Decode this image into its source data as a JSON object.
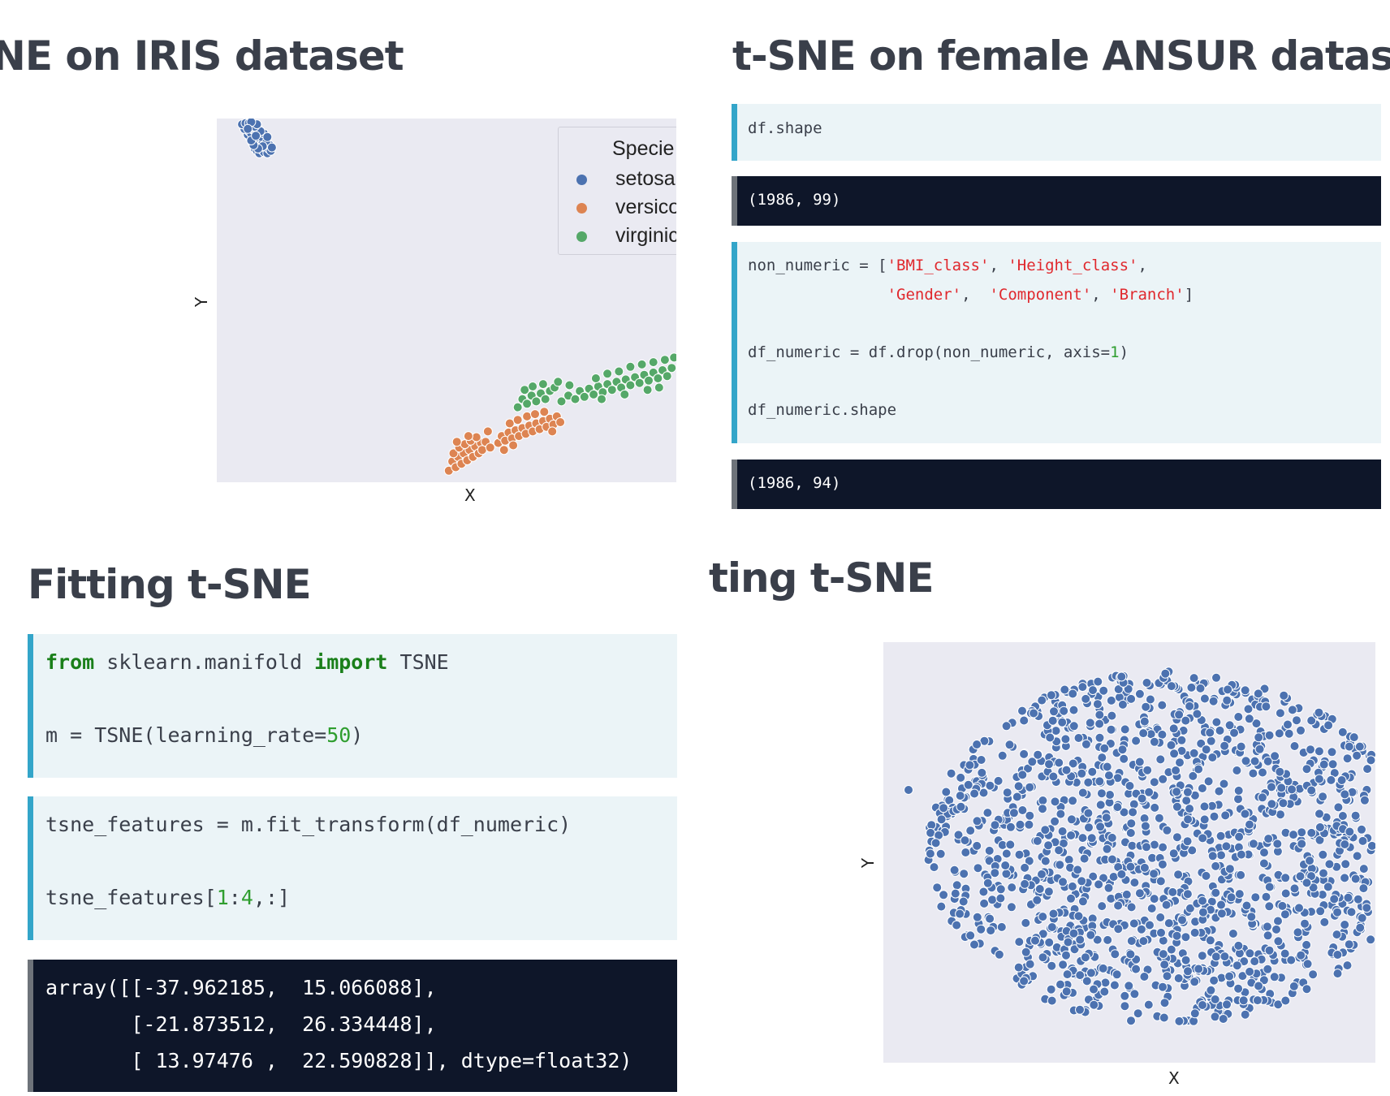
{
  "colors": {
    "title": "#3a3f4a",
    "code_bg": "#ebf4f7",
    "code_accent": "#33a5c9",
    "output_bg": "#0e1629",
    "output_accent": "#6e737a",
    "keyword": "#1a7f1a",
    "string": "#e0282d",
    "number": "#2f9e2f",
    "plot_bg": "#eaeaf2"
  },
  "top_left": {
    "title": "NE on IRIS dataset",
    "chart_data": {
      "type": "scatter",
      "xlabel": "X",
      "ylabel": "Y",
      "legend": {
        "title": "Specie",
        "placement": "top-right",
        "entries": [
          "setosa",
          "versico",
          "virginic"
        ]
      },
      "series": [
        {
          "name": "setosa",
          "color": "#4c72b0",
          "points": [
            [
              0.33,
              0.09
            ],
            [
              0.35,
              0.07
            ],
            [
              0.37,
              0.05
            ],
            [
              0.38,
              0.12
            ],
            [
              0.39,
              0.08
            ],
            [
              0.41,
              0.06
            ],
            [
              0.42,
              0.1
            ],
            [
              0.44,
              0.05
            ],
            [
              0.45,
              0.09
            ],
            [
              0.46,
              0.12
            ],
            [
              0.31,
              0.14
            ],
            [
              0.34,
              0.15
            ],
            [
              0.36,
              0.13
            ],
            [
              0.38,
              0.16
            ],
            [
              0.4,
              0.14
            ],
            [
              0.42,
              0.17
            ],
            [
              0.29,
              0.18
            ],
            [
              0.31,
              0.2
            ],
            [
              0.33,
              0.17
            ],
            [
              0.35,
              0.19
            ],
            [
              0.37,
              0.21
            ],
            [
              0.39,
              0.19
            ],
            [
              0.41,
              0.22
            ],
            [
              0.27,
              0.21
            ],
            [
              0.28,
              0.24
            ],
            [
              0.3,
              0.22
            ],
            [
              0.32,
              0.25
            ],
            [
              0.34,
              0.23
            ],
            [
              0.36,
              0.26
            ],
            [
              0.38,
              0.24
            ],
            [
              0.24,
              0.26
            ],
            [
              0.26,
              0.28
            ],
            [
              0.29,
              0.27
            ],
            [
              0.31,
              0.29
            ],
            [
              0.33,
              0.28
            ],
            [
              0.35,
              0.3
            ],
            [
              0.22,
              0.3
            ],
            [
              0.25,
              0.31
            ],
            [
              0.28,
              0.31
            ],
            [
              0.3,
              0.32
            ],
            [
              0.43,
              0.14
            ],
            [
              0.44,
              0.19
            ],
            [
              0.4,
              0.11
            ],
            [
              0.36,
              0.09
            ],
            [
              0.32,
              0.12
            ],
            [
              0.47,
              0.07
            ],
            [
              0.48,
              0.1
            ],
            [
              0.3,
              0.16
            ],
            [
              0.27,
              0.26
            ],
            [
              0.34,
              0.2
            ]
          ]
        },
        {
          "name": "versico",
          "color": "#dd8452",
          "points": [
            [
              2.02,
              -2.7
            ],
            [
              2.05,
              -2.62
            ],
            [
              2.08,
              -2.67
            ],
            [
              2.1,
              -2.58
            ],
            [
              2.13,
              -2.64
            ],
            [
              2.15,
              -2.55
            ],
            [
              2.18,
              -2.61
            ],
            [
              2.2,
              -2.52
            ],
            [
              2.23,
              -2.58
            ],
            [
              2.25,
              -2.49
            ],
            [
              2.28,
              -2.55
            ],
            [
              2.3,
              -2.46
            ],
            [
              2.06,
              -2.55
            ],
            [
              2.11,
              -2.5
            ],
            [
              2.16,
              -2.47
            ],
            [
              2.21,
              -2.44
            ],
            [
              2.26,
              -2.41
            ],
            [
              2.31,
              -2.52
            ],
            [
              2.34,
              -2.45
            ],
            [
              2.38,
              -2.5
            ],
            [
              2.45,
              -2.46
            ],
            [
              2.48,
              -2.4
            ],
            [
              2.51,
              -2.44
            ],
            [
              2.54,
              -2.37
            ],
            [
              2.57,
              -2.42
            ],
            [
              2.6,
              -2.35
            ],
            [
              2.63,
              -2.4
            ],
            [
              2.66,
              -2.33
            ],
            [
              2.69,
              -2.38
            ],
            [
              2.72,
              -2.31
            ],
            [
              2.75,
              -2.36
            ],
            [
              2.78,
              -2.29
            ],
            [
              2.81,
              -2.34
            ],
            [
              2.84,
              -2.27
            ],
            [
              2.87,
              -2.32
            ],
            [
              2.9,
              -2.25
            ],
            [
              2.93,
              -2.3
            ],
            [
              2.96,
              -2.23
            ],
            [
              2.55,
              -2.29
            ],
            [
              2.62,
              -2.26
            ],
            [
              2.7,
              -2.23
            ],
            [
              2.77,
              -2.21
            ],
            [
              2.85,
              -2.19
            ],
            [
              2.5,
              -2.52
            ],
            [
              2.58,
              -2.48
            ],
            [
              2.19,
              -2.4
            ],
            [
              2.09,
              -2.45
            ],
            [
              2.36,
              -2.36
            ],
            [
              2.92,
              -2.36
            ],
            [
              2.99,
              -2.28
            ]
          ]
        },
        {
          "name": "virginic",
          "color": "#55a868",
          "points": [
            [
              2.62,
              -2.15
            ],
            [
              2.66,
              -2.08
            ],
            [
              2.7,
              -2.12
            ],
            [
              2.74,
              -2.05
            ],
            [
              2.78,
              -2.1
            ],
            [
              2.82,
              -2.03
            ],
            [
              2.86,
              -2.08
            ],
            [
              2.9,
              -2.01
            ],
            [
              2.68,
              -2.0
            ],
            [
              2.75,
              -1.97
            ],
            [
              2.84,
              -1.95
            ],
            [
              2.94,
              -1.98
            ],
            [
              3.0,
              -2.1
            ],
            [
              3.06,
              -2.05
            ],
            [
              3.12,
              -2.08
            ],
            [
              3.16,
              -2.01
            ],
            [
              3.2,
              -2.06
            ],
            [
              3.24,
              -1.99
            ],
            [
              3.28,
              -2.04
            ],
            [
              3.32,
              -1.97
            ],
            [
              3.36,
              -2.02
            ],
            [
              3.4,
              -1.95
            ],
            [
              3.44,
              -2.0
            ],
            [
              3.48,
              -1.93
            ],
            [
              3.52,
              -1.98
            ],
            [
              3.56,
              -1.91
            ],
            [
              3.6,
              -1.96
            ],
            [
              3.64,
              -1.89
            ],
            [
              3.68,
              -1.94
            ],
            [
              3.72,
              -1.87
            ],
            [
              3.76,
              -1.92
            ],
            [
              3.8,
              -1.85
            ],
            [
              3.84,
              -1.9
            ],
            [
              3.88,
              -1.83
            ],
            [
              3.92,
              -1.88
            ],
            [
              3.96,
              -1.81
            ],
            [
              3.3,
              -1.9
            ],
            [
              3.4,
              -1.86
            ],
            [
              3.5,
              -1.84
            ],
            [
              3.6,
              -1.8
            ],
            [
              3.7,
              -1.78
            ],
            [
              3.8,
              -1.76
            ],
            [
              3.9,
              -1.74
            ],
            [
              3.98,
              -1.72
            ],
            [
              3.35,
              -2.08
            ],
            [
              3.55,
              -2.04
            ],
            [
              3.75,
              -2.0
            ],
            [
              3.85,
              -1.98
            ],
            [
              2.97,
              -1.93
            ],
            [
              3.07,
              -1.96
            ]
          ]
        }
      ]
    }
  },
  "top_right": {
    "title": "t-SNE on female ANSUR dataset",
    "code1": "df.shape",
    "out1": "(1986, 99)",
    "code2": {
      "l1_a": "non_numeric = [",
      "l1_s1": "'BMI_class'",
      "l1_b": ", ",
      "l1_s2": "'Height_class'",
      "l1_c": ",",
      "l2_indent": "               ",
      "l2_s1": "'Gender'",
      "l2_b": ",  ",
      "l2_s2": "'Component'",
      "l2_c": ", ",
      "l2_s3": "'Branch'",
      "l2_d": "]",
      "l3_a": "df_numeric = df.drop(non_numeric, axis=",
      "l3_n": "1",
      "l3_b": ")",
      "l4": "df_numeric.shape"
    },
    "out2": "(1986, 94)"
  },
  "bottom_left": {
    "title": "Fitting t-SNE",
    "code1": {
      "kw_from": "from",
      "mod": " sklearn.manifold ",
      "kw_import": "import",
      "cls": " TSNE",
      "l2_a": "m = TSNE(learning_rate=",
      "l2_n": "50",
      "l2_b": ")"
    },
    "code2": {
      "l1": "tsne_features = m.fit_transform(df_numeric)",
      "l2_a": "tsne_features[",
      "l2_n1": "1",
      "l2_colon": ":",
      "l2_n2": "4",
      "l2_b": ",:]"
    },
    "output": {
      "l1": "array([[-37.962185,  15.066088],",
      "l2": "       [-21.873512,  26.334448],",
      "l3": "       [ 13.97476 ,  22.590828]], dtype=float32)"
    }
  },
  "bottom_right": {
    "title": "ting t-SNE",
    "chart_data": {
      "type": "scatter",
      "xlabel": "X",
      "ylabel": "Y",
      "series": [
        {
          "color": "#4c72b0",
          "count": 1986
        }
      ]
    }
  }
}
